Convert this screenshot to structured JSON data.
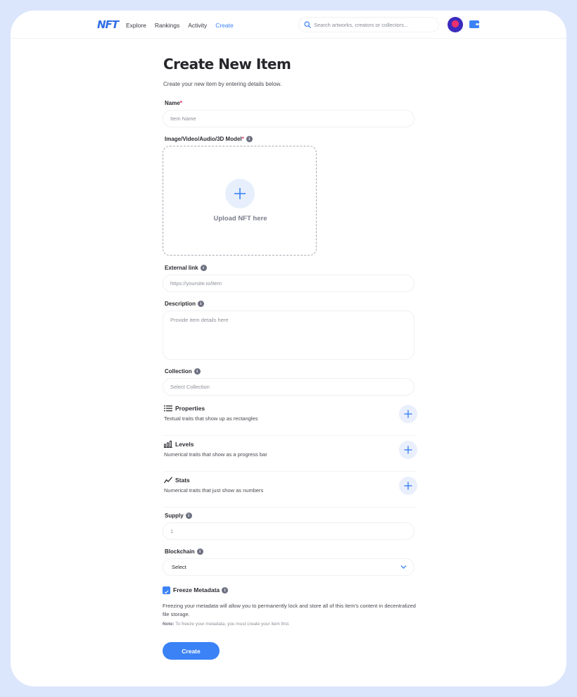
{
  "header": {
    "logo": "NFT",
    "nav": [
      {
        "label": "Explore",
        "active": false
      },
      {
        "label": "Rankings",
        "active": false
      },
      {
        "label": "Activity",
        "active": false
      },
      {
        "label": "Create",
        "active": true
      }
    ],
    "search_placeholder": "Search artworks, creators or collectors...",
    "icons": {
      "search": "search-icon",
      "avatar": "user-avatar",
      "wallet": "wallet-icon"
    }
  },
  "page": {
    "title": "Create New Item",
    "subtitle": "Create your new item by entering details below."
  },
  "form": {
    "name": {
      "label": "Name",
      "required": "*",
      "placeholder": "Item Name"
    },
    "media": {
      "label": "Image/Video/Audio/3D Model",
      "required": "*",
      "upload_text": "Upload NFT here"
    },
    "external_link": {
      "label": "External link",
      "placeholder": "https://yoursite.io/item"
    },
    "description": {
      "label": "Description",
      "placeholder": "Provide item details here"
    },
    "collection": {
      "label": "Collection",
      "placeholder": "Select Collection"
    },
    "traits": [
      {
        "title": "Properties",
        "description": "Textual traits that show up as rectangles",
        "icon": "list-icon"
      },
      {
        "title": "Levels",
        "description": "Numerical traits that show as a progress bar",
        "icon": "bar-chart-icon"
      },
      {
        "title": "Stats",
        "description": "Numerical traits that just show as numbers",
        "icon": "trend-line-icon"
      }
    ],
    "supply": {
      "label": "Supply",
      "value": "1"
    },
    "blockchain": {
      "label": "Blockchain",
      "value": "Select"
    },
    "freeze": {
      "label": "Freeze Metadata",
      "checked": true,
      "description": "Freezing your metadata will allow you to permanently lock and store all of this item's content in decentralized file storage.",
      "note_label": "Note:",
      "note_text": " To freeze your metadata, you must create your item first."
    },
    "submit_label": "Create"
  },
  "colors": {
    "accent": "#3b82f6",
    "frame": "#dbe6fc",
    "required": "#e0245e"
  }
}
